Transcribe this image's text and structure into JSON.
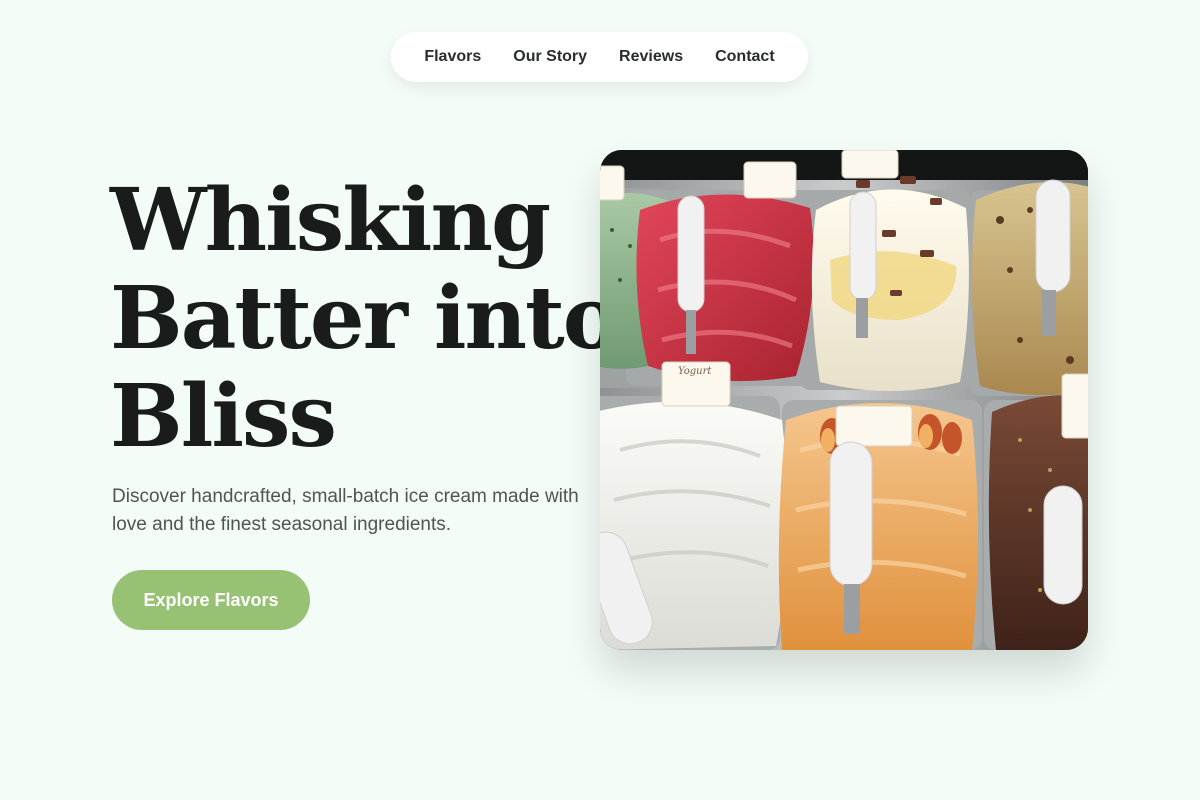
{
  "nav": {
    "items": [
      {
        "label": "Flavors"
      },
      {
        "label": "Our Story"
      },
      {
        "label": "Reviews"
      },
      {
        "label": "Contact"
      }
    ]
  },
  "hero": {
    "headline_lines": [
      "Whisking",
      "Batter into",
      "Bliss"
    ],
    "subtitle": "Discover handcrafted, small-batch ice cream made with love and the finest seasonal ingredients.",
    "cta_label": "Explore Flavors",
    "image": {
      "subject": "gelato display case with trays of flavored ice cream and white scoops",
      "tray_labels": [
        "Yogurt"
      ]
    }
  },
  "colors": {
    "background": "#f3fcf7",
    "accent": "#97c274",
    "text": "#1a1c1b"
  }
}
